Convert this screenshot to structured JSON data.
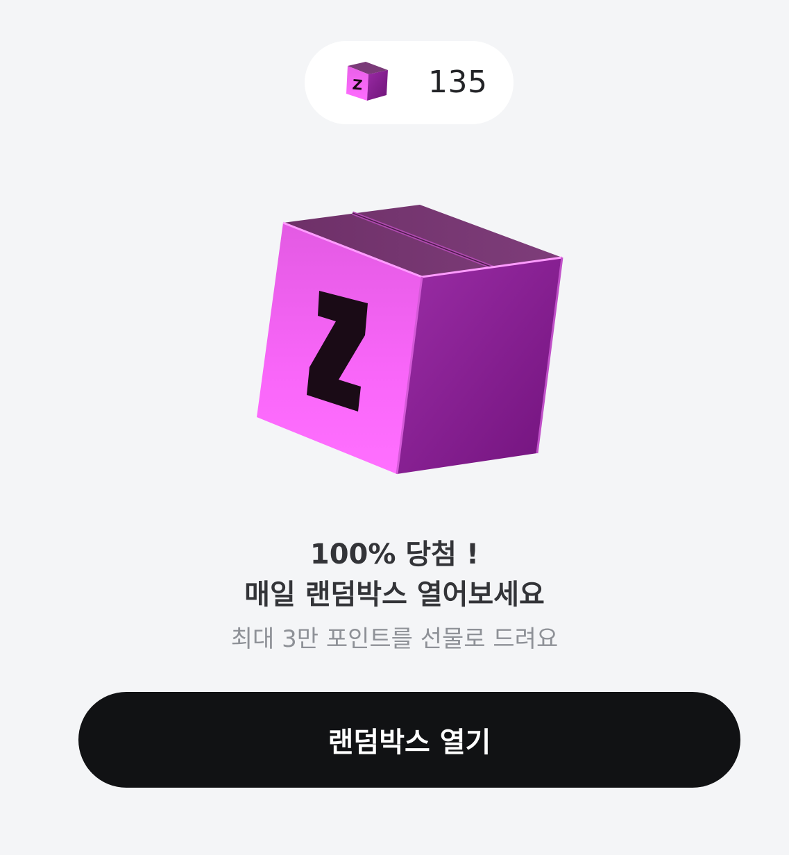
{
  "points": {
    "icon": "z-box-icon",
    "count": "135"
  },
  "hero": {
    "icon": "z-random-box-icon",
    "letter": "Z"
  },
  "promo": {
    "headline_line1": "100% 당첨 !",
    "headline_line2": "매일 랜덤박스 열어보세요",
    "subtext": "최대 3만 포인트를 선물로 드려요"
  },
  "cta": {
    "label": "랜덤박스 열기"
  },
  "colors": {
    "background": "#f4f5f7",
    "button": "#111214",
    "box_pink": "#ff66ff",
    "box_purple": "#8a1f95"
  }
}
